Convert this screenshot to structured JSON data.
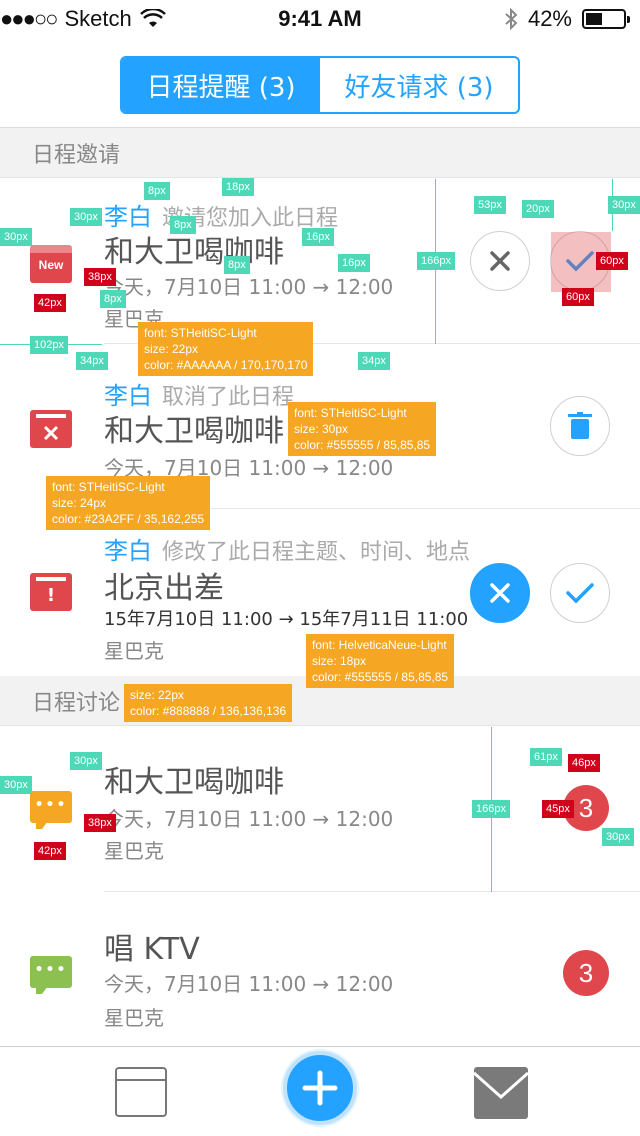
{
  "status_bar": {
    "carrier": "Sketch",
    "time": "9:41 AM",
    "battery": "42%"
  },
  "segment": {
    "tab1": "日程提醒 (3)",
    "tab2": "好友请求 (3)"
  },
  "sections": {
    "invites": "日程邀请",
    "discussions": "日程讨论"
  },
  "invites": [
    {
      "name": "李白",
      "action": "邀请您加入此日程",
      "title": "和大卫喝咖啡",
      "time": "今天，7月10日 11:00  →  12:00",
      "place": "星巴克",
      "badge": "New"
    },
    {
      "name": "李白",
      "action": "取消了此日程",
      "title": "和大卫喝咖啡",
      "time": "今天，7月10日 11:00  →  12:00",
      "place": ""
    },
    {
      "name": "李白",
      "action": "修改了此日程主题、时间、地点",
      "title": "北京出差",
      "time": "15年7月10日 11:00  →  15年7月11日 11:00",
      "place": "星巴克"
    }
  ],
  "discussions": [
    {
      "title": "和大卫喝咖啡",
      "time": "今天，7月10日 11:00  →  12:00",
      "place": "星巴克",
      "count": "3"
    },
    {
      "title": "唱 KTV",
      "time": "今天，7月10日 11:00  →  12:00",
      "place": "星巴克",
      "count": "3"
    }
  ],
  "annotations": {
    "a1": [
      "font: STHeitiSC-Light",
      "size: 22px",
      "color: #AAAAAA / 170,170,170"
    ],
    "a2": [
      "font: STHeitiSC-Light",
      "size: 30px",
      "color: #555555 / 85,85,85"
    ],
    "a3": [
      "font: STHeitiSC-Light",
      "size: 24px",
      "color: #23A2FF / 35,162,255"
    ],
    "a4": [
      "font: HelveticaNeue-Light",
      "size: 18px",
      "color: #555555 / 85,85,85"
    ],
    "a5": [
      "size: 22px",
      "color: #888888 / 136,136,136"
    ]
  },
  "measure": {
    "m8": "8px",
    "m18": "18px",
    "m30": "30px",
    "m16": "16px",
    "m38": "38px",
    "m42": "42px",
    "m166": "166px",
    "m53": "53px",
    "m20": "20px",
    "m60": "60px",
    "m102": "102px",
    "m34": "34px",
    "m61": "61px",
    "m46": "46px",
    "m45": "45px"
  },
  "colors": {
    "accent": "#23A2FF",
    "red": "#E0474C",
    "orange": "#F5A623",
    "green": "#8CC152"
  }
}
